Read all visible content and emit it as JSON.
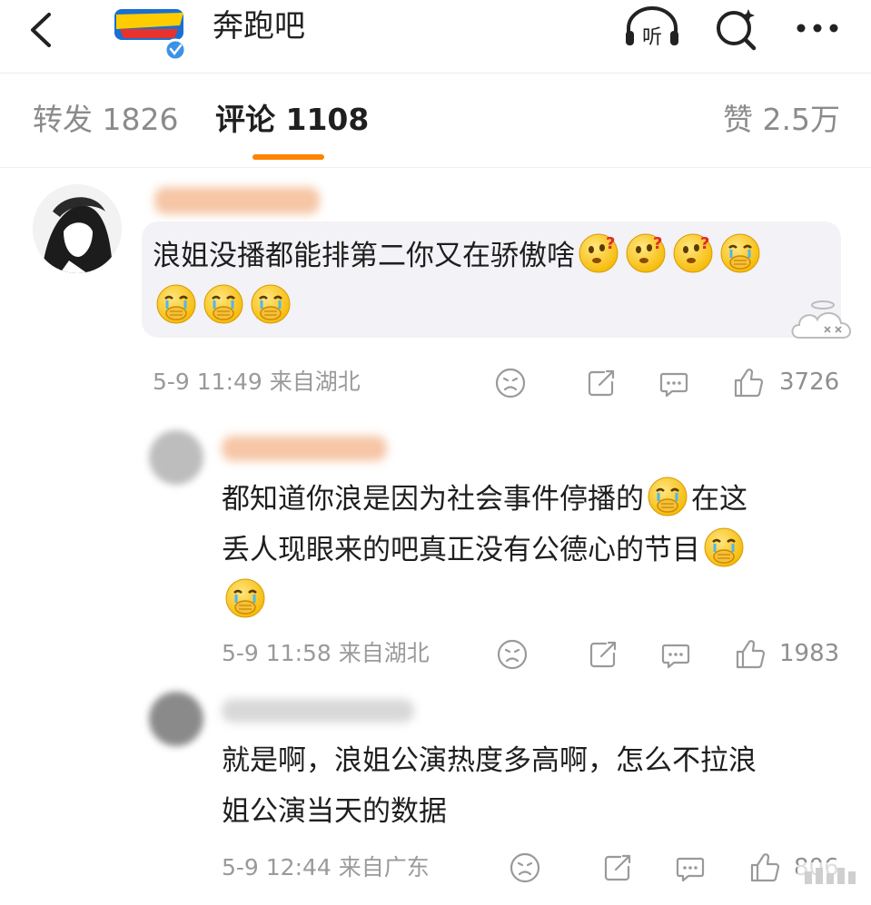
{
  "header": {
    "title": "奔跑吧",
    "listen_label": "听"
  },
  "tabs": {
    "repost": "转发 1826",
    "comment": "评论 1108",
    "like": "赞 2.5万"
  },
  "colors": {
    "accent": "#ff8200",
    "bubble": "#f3f2f6",
    "meta_text": "#9a9a9a"
  },
  "comments": [
    {
      "text": "浪姐没播都能排第二你又在骄傲啥",
      "emojis_inline": [
        "doge-question-emoji",
        "doge-question-emoji",
        "doge-question-emoji",
        "crying-emoji"
      ],
      "emojis_line2": [
        "crying-emoji",
        "crying-emoji",
        "crying-emoji"
      ],
      "meta": "5-9 11:49 来自湖北",
      "likes": "3726"
    },
    {
      "line1": "都知道你浪是因为社会事件停播的",
      "line1_tail": "在这",
      "line2": "丢人现眼来的吧真正没有公德心的节目",
      "meta": "5-9 11:58 来自湖北",
      "likes": "1983"
    },
    {
      "line1": "就是啊，浪姐公演热度多高啊，怎么不拉浪",
      "line2": "姐公演当天的数据",
      "meta": "5-9 12:44 来自广东",
      "likes": "806"
    }
  ]
}
